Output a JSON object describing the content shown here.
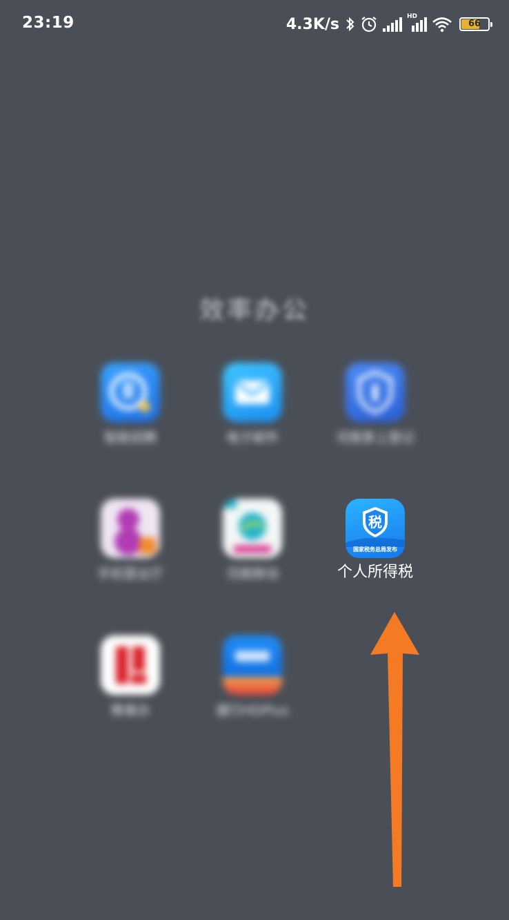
{
  "status_bar": {
    "time": "23:19",
    "net_speed": "4.3K/s",
    "hd_label": "HD",
    "battery_level": "66",
    "icons": [
      "bluetooth-icon",
      "alarm-icon",
      "signal-icon",
      "signal-hd-icon",
      "wifi-icon",
      "battery-icon"
    ]
  },
  "folder": {
    "title": "效率办公",
    "apps": [
      {
        "label": "智联招聘",
        "icon": "zhaopin-app-icon",
        "color": "#2b86f5",
        "blurred": true
      },
      {
        "label": "电子邮件",
        "icon": "email-app-icon",
        "color": "#2aaaf7",
        "blurred": true
      },
      {
        "label": "河南掌上登记",
        "icon": "shield-app-icon",
        "color": "#3a76ea",
        "blurred": true
      },
      {
        "label": "手机营业厅",
        "icon": "mobile-hall-app-icon",
        "color": "#a53aa8",
        "blurred": true
      },
      {
        "label": "河南移动",
        "icon": "china-mobile-app-icon",
        "color": "#1aa6c9",
        "blurred": true
      },
      {
        "label": "个人所得税",
        "icon": "tax-app-icon",
        "color": "#1a8cf5",
        "blurred": false,
        "icon_text": "税",
        "icon_caption": "国家税务总局发布"
      },
      {
        "label": "豫事办",
        "icon": "yushiban-app-icon",
        "color": "#d8232a",
        "blurred": true
      },
      {
        "label": "建行HDPlus",
        "icon": "bank-app-icon",
        "color": "#1f7fe8",
        "blurred": true
      }
    ]
  },
  "annotation": {
    "arrow_color": "#f47a24"
  }
}
